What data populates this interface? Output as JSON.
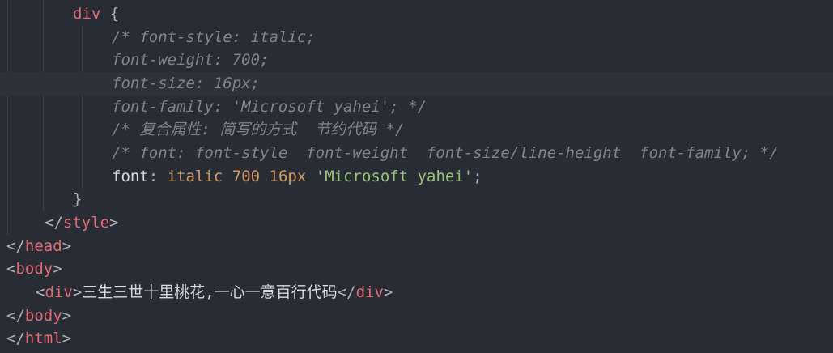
{
  "code": {
    "l1": {
      "selector": "div",
      "brace": " {"
    },
    "l2": {
      "comment": "/* font-style: italic;"
    },
    "l3": {
      "comment": "font-weight: 700;"
    },
    "l4": {
      "comment": "font-size: 16px;"
    },
    "l5": {
      "comment": "font-family: 'Microsoft yahei'; */"
    },
    "l6": {
      "comment": "/* 复合属性: 简写的方式  节约代码 */"
    },
    "l7": {
      "comment": "/* font: font-style  font-weight  font-size/line-height  font-family; */"
    },
    "l8": {
      "prop": "font",
      "colon": ": ",
      "kw1": "italic",
      "num1": "700",
      "num2": "16px",
      "str": "'Microsoft yahei'",
      "semi": ";"
    },
    "l9": {
      "brace": "}"
    },
    "l10": {
      "open": "</",
      "tag": "style",
      "close": ">"
    },
    "l11": {
      "open": "</",
      "tag": "head",
      "close": ">"
    },
    "l12": {
      "open": "<",
      "tag": "body",
      "close": ">"
    },
    "l13": {
      "open1": "<",
      "tag1": "div",
      "close1": ">",
      "text": "三生三世十里桃花,一心一意百行代码",
      "open2": "</",
      "tag2": "div",
      "close2": ">"
    },
    "l14": {
      "open": "</",
      "tag": "body",
      "close": ">"
    },
    "l15": {
      "open": "</",
      "tag": "html",
      "close": ">"
    }
  }
}
